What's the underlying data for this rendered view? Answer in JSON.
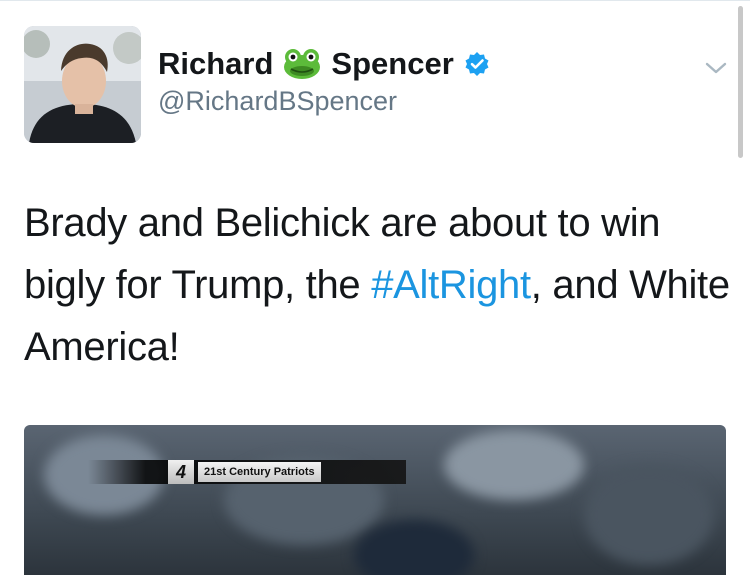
{
  "tweet": {
    "name_first": "Richard",
    "name_last": "Spencer",
    "name_emoji_icon": "frog-face-icon",
    "verified_icon": "verified-badge-icon",
    "handle": "@RichardBSpencer",
    "text_before": "Brady and Belichick are about to win bigly for Trump, the ",
    "hashtag": "#AltRight",
    "text_after": ", and White America!",
    "hashtag_color": "#1b95e0",
    "verified_color": "#1da1f2"
  },
  "media": {
    "overlay_number": "4",
    "overlay_label": "21st Century Patriots"
  },
  "menu": {
    "chevron_icon": "chevron-down-icon"
  }
}
